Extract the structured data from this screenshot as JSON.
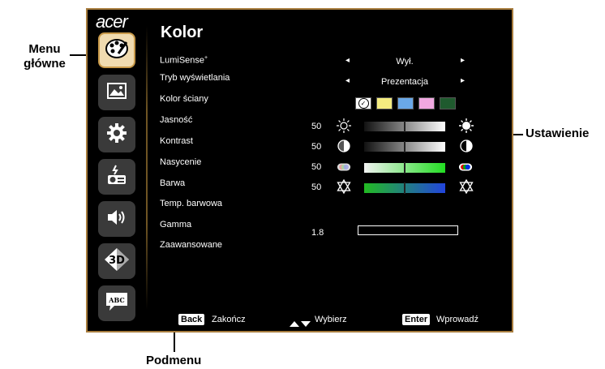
{
  "callouts": {
    "main_menu_line1": "Menu",
    "main_menu_line2": "główne",
    "setting": "Ustawienie",
    "submenu": "Podmenu"
  },
  "osd": {
    "logo": "acer",
    "title": "Kolor",
    "menu_items": [
      {
        "label": "LumiSense",
        "sup": "+"
      },
      {
        "label": "Tryb wyświetlania"
      },
      {
        "label": "Kolor ściany"
      },
      {
        "label": "Jasność"
      },
      {
        "label": "Kontrast"
      },
      {
        "label": "Nasycenie"
      },
      {
        "label": "Barwa"
      },
      {
        "label": "Temp. barwowa"
      },
      {
        "label": "Gamma"
      },
      {
        "label": "Zaawansowane"
      }
    ],
    "lumisense_value": "Wył.",
    "display_mode_value": "Prezentacja",
    "arrow_left": "◂",
    "arrow_right": "▸",
    "wall_colors": [
      "#ffffff",
      "#f4ec80",
      "#6aa8e8",
      "#f0a8e0",
      "#1f5a2e"
    ],
    "wall_selected_mark": "✓",
    "brightness_value": "50",
    "contrast_value": "50",
    "saturation_value": "50",
    "hue_value": "50",
    "gamma_value": "1.8",
    "sidebar_icons": [
      "palette-icon",
      "image-icon",
      "gear-icon",
      "projector-icon",
      "speaker-icon",
      "3d-icon",
      "language-icon"
    ],
    "footer": {
      "back_key": "Back",
      "back_label": "Zakończ",
      "select_label": "Wybierz",
      "enter_key": "Enter",
      "enter_label": "Wprowadź"
    }
  }
}
